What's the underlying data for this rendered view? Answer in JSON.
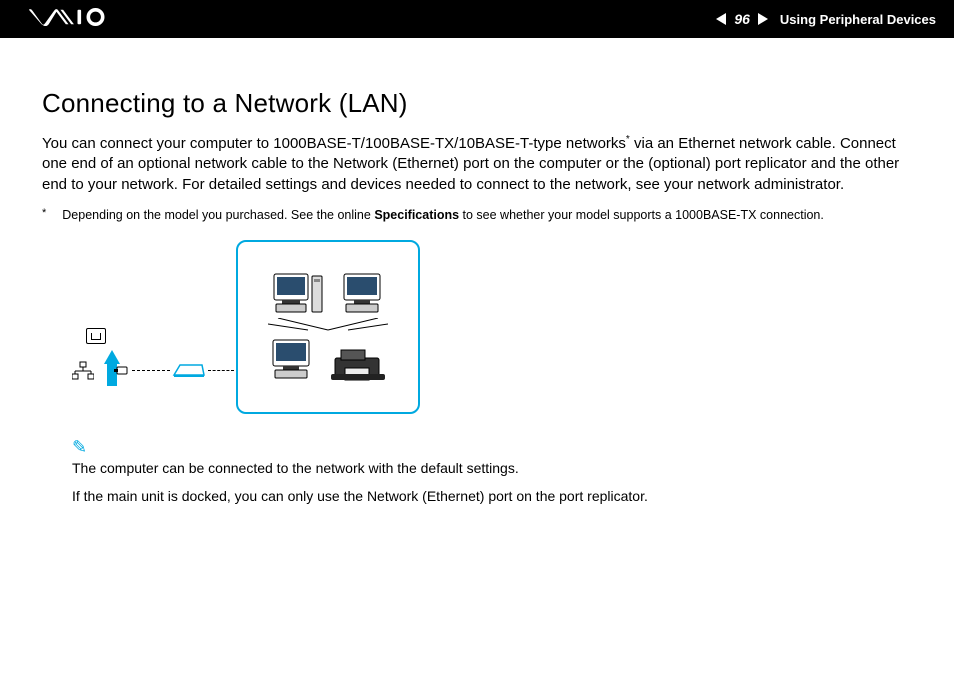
{
  "header": {
    "page_number": "96",
    "section": "Using Peripheral Devices"
  },
  "title": "Connecting to a Network (LAN)",
  "paragraph_parts": {
    "a": "You can connect your computer to 1000BASE-T/100BASE-TX/10BASE-T-type networks",
    "b": " via an Ethernet network cable. Connect one end of an optional network cable to the Network (Ethernet) port on the computer or the (optional) port replicator and the other end to your network. For detailed settings and devices needed to connect to the network, see your network administrator."
  },
  "footnote": {
    "mark": "*",
    "before": "Depending on the model you purchased. See the online ",
    "bold": "Specifications",
    "after": " to see whether your model supports a 1000BASE-TX connection."
  },
  "notes": {
    "line1": "The computer can be connected to the network with the default settings.",
    "line2": "If the main unit is docked, you can only use the Network (Ethernet) port on the port replicator."
  }
}
